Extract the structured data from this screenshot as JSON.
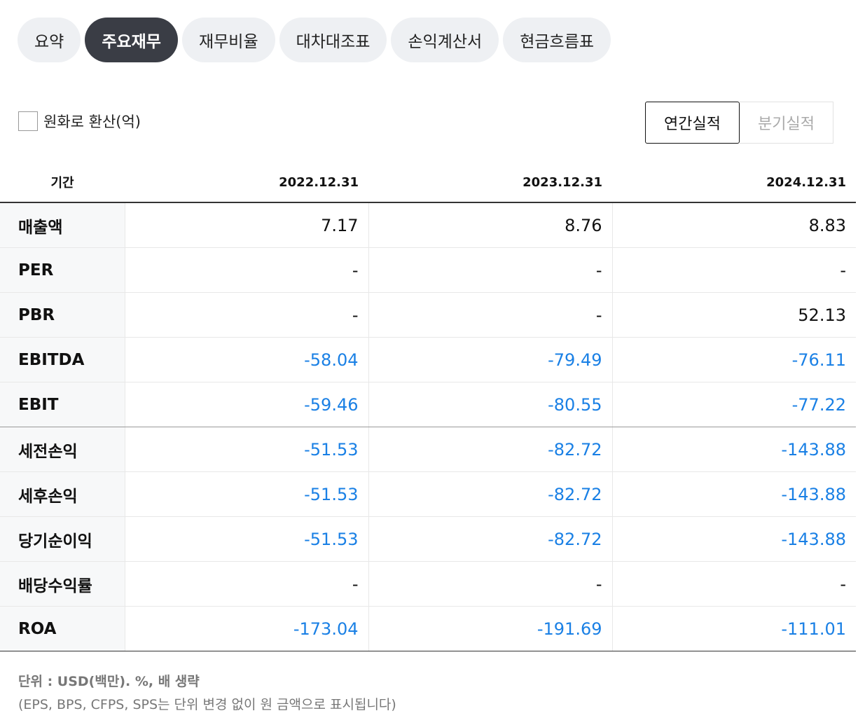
{
  "tabs": [
    {
      "label": "요약",
      "active": false
    },
    {
      "label": "주요재무",
      "active": true
    },
    {
      "label": "재무비율",
      "active": false
    },
    {
      "label": "대차대조표",
      "active": false
    },
    {
      "label": "손익계산서",
      "active": false
    },
    {
      "label": "현금흐름표",
      "active": false
    }
  ],
  "krw_toggle": {
    "label": "원화로 환산(억)",
    "checked": false
  },
  "period_toggle": {
    "annual": "연간실적",
    "quarterly": "분기실적",
    "selected": "annual"
  },
  "table": {
    "header_label": "기간",
    "periods": [
      "2022.12.31",
      "2023.12.31",
      "2024.12.31"
    ],
    "rows": [
      {
        "label": "매출액",
        "values": [
          "7.17",
          "8.76",
          "8.83"
        ]
      },
      {
        "label": "PER",
        "values": [
          "-",
          "-",
          "-"
        ]
      },
      {
        "label": "PBR",
        "values": [
          "-",
          "-",
          "52.13"
        ]
      },
      {
        "label": "EBITDA",
        "values": [
          "-58.04",
          "-79.49",
          "-76.11"
        ]
      },
      {
        "label": "EBIT",
        "values": [
          "-59.46",
          "-80.55",
          "-77.22"
        ]
      },
      {
        "label": "세전손익",
        "values": [
          "-51.53",
          "-82.72",
          "-143.88"
        ]
      },
      {
        "label": "세후손익",
        "values": [
          "-51.53",
          "-82.72",
          "-143.88"
        ]
      },
      {
        "label": "당기순이익",
        "values": [
          "-51.53",
          "-82.72",
          "-143.88"
        ]
      },
      {
        "label": "배당수익률",
        "values": [
          "-",
          "-",
          "-"
        ]
      },
      {
        "label": "ROA",
        "values": [
          "-173.04",
          "-191.69",
          "-111.01"
        ]
      }
    ]
  },
  "footer": {
    "unit": "단위 : USD(백만). %, 배 생략",
    "note": "(EPS, BPS, CFPS, SPS는 단위 변경 없이 원 금액으로 표시됩니다)"
  },
  "colors": {
    "negative": "#1a80e5",
    "active_tab": "#3a3d45",
    "tab_bg": "#eef0f3"
  }
}
